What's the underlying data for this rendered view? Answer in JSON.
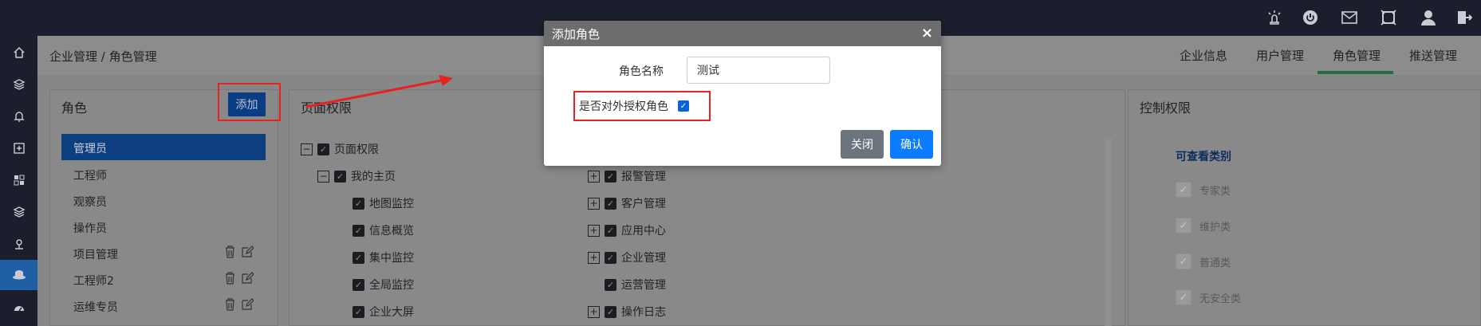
{
  "breadcrumb": "企业管理 / 角色管理",
  "tabs": [
    {
      "label": "企业信息",
      "active": false
    },
    {
      "label": "用户管理",
      "active": false
    },
    {
      "label": "角色管理",
      "active": true
    },
    {
      "label": "推送管理",
      "active": false
    }
  ],
  "role_panel": {
    "title": "角色",
    "add_label": "添加",
    "roles": [
      {
        "label": "管理员",
        "selected": true,
        "actions": false
      },
      {
        "label": "工程师",
        "selected": false,
        "actions": false
      },
      {
        "label": "观察员",
        "selected": false,
        "actions": false
      },
      {
        "label": "操作员",
        "selected": false,
        "actions": false
      },
      {
        "label": "项目管理",
        "selected": false,
        "actions": true
      },
      {
        "label": "工程师2",
        "selected": false,
        "actions": true
      },
      {
        "label": "运维专员",
        "selected": false,
        "actions": true
      }
    ]
  },
  "page_permission": {
    "title": "页面权限",
    "left_tree": [
      {
        "label": "页面权限",
        "expander": "−",
        "level": 0
      },
      {
        "label": "我的主页",
        "expander": "−",
        "level": 1
      },
      {
        "label": "地图监控",
        "expander": "",
        "level": 2
      },
      {
        "label": "信息概览",
        "expander": "",
        "level": 2
      },
      {
        "label": "集中监控",
        "expander": "",
        "level": 2
      },
      {
        "label": "全局监控",
        "expander": "",
        "level": 2
      },
      {
        "label": "企业大屏",
        "expander": "",
        "level": 2
      }
    ],
    "right_tree": [
      {
        "label": "报警管理",
        "expander": "+"
      },
      {
        "label": "客户管理",
        "expander": "+"
      },
      {
        "label": "应用中心",
        "expander": "+"
      },
      {
        "label": "企业管理",
        "expander": "+"
      },
      {
        "label": "运营管理",
        "expander": ""
      },
      {
        "label": "操作日志",
        "expander": "+"
      }
    ]
  },
  "control_permission": {
    "title": "控制权限",
    "subtitle": "可查看类别",
    "items": [
      "专家类",
      "维护类",
      "普通类",
      "无安全类"
    ]
  },
  "modal": {
    "title": "添加角色",
    "close_symbol": "×",
    "name_label": "角色名称",
    "name_value": "测试",
    "authorize_label": "是否对外授权角色",
    "authorize_checked": true,
    "close_label": "关闭",
    "confirm_label": "确认"
  },
  "icons": {
    "top": [
      "alarm-light-icon",
      "power-icon",
      "mail-icon",
      "fullscreen-icon",
      "user-icon",
      "logout-icon"
    ],
    "side": [
      "home-icon",
      "layers-icon",
      "bell-icon",
      "plus-square-icon",
      "grid-icon",
      "layers-icon",
      "map-pin-icon",
      "role-hat-icon",
      "dashboard-icon"
    ]
  },
  "colors": {
    "accent": "#0b7cff",
    "selected_row": "#0d3e80",
    "annotation": "#e62222"
  }
}
